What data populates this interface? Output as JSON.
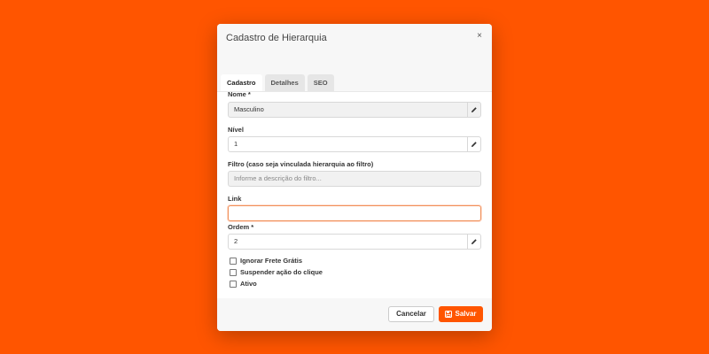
{
  "modal": {
    "title": "Cadastro de Hierarquia",
    "close_label": "×"
  },
  "tabs": [
    {
      "label": "Cadastro",
      "active": true
    },
    {
      "label": "Detalhes",
      "active": false
    },
    {
      "label": "SEO",
      "active": false
    }
  ],
  "form": {
    "nome": {
      "label": "Nome *",
      "value": "Masculino",
      "disabled": true
    },
    "nivel": {
      "label": "Nível",
      "value": "1"
    },
    "filtro": {
      "label": "Filtro (caso seja vinculada hierarquia ao filtro)",
      "placeholder": "Informe a descrição do filtro..."
    },
    "link": {
      "label": "Link",
      "value": ""
    },
    "ordem": {
      "label": "Ordem *",
      "value": "2"
    },
    "checkboxes": [
      {
        "label": "Ignorar Frete Grátis",
        "checked": false
      },
      {
        "label": "Suspender ação do clique",
        "checked": false
      },
      {
        "label": "Ativo",
        "checked": false
      }
    ]
  },
  "footer": {
    "cancel_label": "Cancelar",
    "save_label": "Salvar"
  },
  "colors": {
    "background": "#ff5500",
    "accent": "#ff5500"
  },
  "icons": {
    "edit": "pencil-icon",
    "close": "close-icon",
    "save": "floppy-disk-icon"
  }
}
